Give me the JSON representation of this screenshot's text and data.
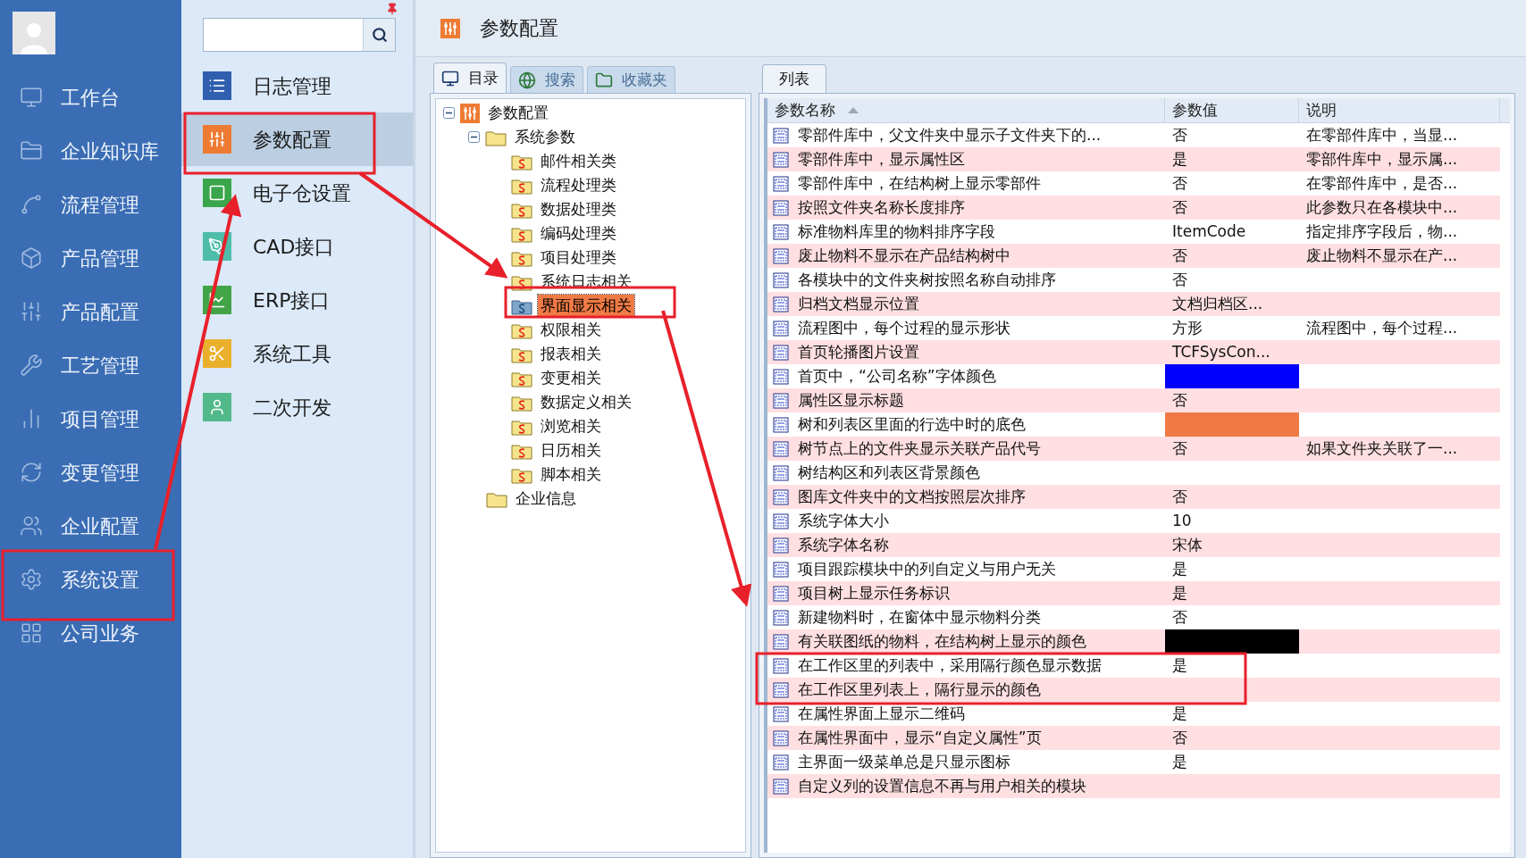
{
  "sidebar": {
    "items": [
      {
        "label": "工作台"
      },
      {
        "label": "企业知识库"
      },
      {
        "label": "流程管理"
      },
      {
        "label": "产品管理"
      },
      {
        "label": "产品配置"
      },
      {
        "label": "工艺管理"
      },
      {
        "label": "项目管理"
      },
      {
        "label": "变更管理"
      },
      {
        "label": "企业配置"
      },
      {
        "label": "系统设置"
      },
      {
        "label": "公司业务"
      }
    ]
  },
  "submenu": {
    "items": [
      {
        "label": "日志管理",
        "color": "#2f5fae",
        "selected": false
      },
      {
        "label": "参数配置",
        "color": "#ee7b33",
        "selected": true
      },
      {
        "label": "电子仓设置",
        "color": "#3aa64b",
        "selected": false
      },
      {
        "label": "CAD接口",
        "color": "#4dbdaa",
        "selected": false
      },
      {
        "label": "ERP接口",
        "color": "#43a447",
        "selected": false
      },
      {
        "label": "系统工具",
        "color": "#eab02b",
        "selected": false
      },
      {
        "label": "二次开发",
        "color": "#52b98a",
        "selected": false
      }
    ]
  },
  "page_header": {
    "title": "参数配置"
  },
  "left_tabs": [
    {
      "label": "目录",
      "selected": true
    },
    {
      "label": "搜索",
      "selected": false
    },
    {
      "label": "收藏夹",
      "selected": false
    }
  ],
  "tree": [
    {
      "label": "参数配置",
      "kind": "root",
      "expanded": true,
      "selected": false,
      "children": [
        {
          "label": "系统参数",
          "kind": "folder",
          "expanded": true,
          "selected": false,
          "children": [
            {
              "label": "邮件相关类",
              "kind": "param",
              "selected": false
            },
            {
              "label": "流程处理类",
              "kind": "param",
              "selected": false
            },
            {
              "label": "数据处理类",
              "kind": "param",
              "selected": false
            },
            {
              "label": "编码处理类",
              "kind": "param",
              "selected": false
            },
            {
              "label": "项目处理类",
              "kind": "param",
              "selected": false
            },
            {
              "label": "系统日志相关",
              "kind": "param",
              "selected": false
            },
            {
              "label": "界面显示相关",
              "kind": "param",
              "selected": true
            },
            {
              "label": "权限相关",
              "kind": "param",
              "selected": false
            },
            {
              "label": "报表相关",
              "kind": "param",
              "selected": false
            },
            {
              "label": "变更相关",
              "kind": "param",
              "selected": false
            },
            {
              "label": "数据定义相关",
              "kind": "param",
              "selected": false
            },
            {
              "label": "浏览相关",
              "kind": "param",
              "selected": false
            },
            {
              "label": "日历相关",
              "kind": "param",
              "selected": false
            },
            {
              "label": "脚本相关",
              "kind": "param",
              "selected": false
            }
          ]
        },
        {
          "label": "企业信息",
          "kind": "folder",
          "selected": false
        }
      ]
    }
  ],
  "list_tab": {
    "label": "列表",
    "selected": true
  },
  "table": {
    "columns": [
      {
        "label": "参数名称",
        "sorted": true
      },
      {
        "label": "参数值",
        "sorted": false
      },
      {
        "label": "说明",
        "sorted": false
      }
    ],
    "rows": [
      {
        "name": "零部件库中，父文件夹中显示子文件夹下的...",
        "value": "否",
        "description": "在零部件库中，当显..."
      },
      {
        "name": "零部件库中，显示属性区",
        "value": "是",
        "description": "零部件库中，显示属..."
      },
      {
        "name": "零部件库中，在结构树上显示零部件",
        "value": "否",
        "description": "在零部件库中，是否..."
      },
      {
        "name": "按照文件夹名称长度排序",
        "value": "否",
        "description": "此参数只在各模块中..."
      },
      {
        "name": "标准物料库里的物料排序字段",
        "value": "ItemCode",
        "description": "指定排序字段后，物..."
      },
      {
        "name": "废止物料不显示在产品结构树中",
        "value": "否",
        "description": "废止物料不显示在产..."
      },
      {
        "name": "各模块中的文件夹树按照名称自动排序",
        "value": "否"
      },
      {
        "name": "归档文档显示位置",
        "value": "文档归档区..."
      },
      {
        "name": "流程图中，每个过程的显示形状",
        "value": "方形",
        "description": "流程图中，每个过程..."
      },
      {
        "name": "首页轮播图片设置",
        "value": "TCFSysCon..."
      },
      {
        "name": "首页中，“公司名称”字体颜色",
        "color": "#0000ff"
      },
      {
        "name": "属性区显示标题",
        "value": "否"
      },
      {
        "name": "树和列表区里面的行选中时的底色",
        "color": "#f07a45"
      },
      {
        "name": "树节点上的文件夹显示关联产品代号",
        "value": "否",
        "description": "如果文件夹关联了一..."
      },
      {
        "name": "树结构区和列表区背景颜色"
      },
      {
        "name": "图库文件夹中的文档按照层次排序",
        "value": "否"
      },
      {
        "name": "系统字体大小",
        "value": "10"
      },
      {
        "name": "系统字体名称",
        "value": "宋体"
      },
      {
        "name": "项目跟踪模块中的列自定义与用户无关",
        "value": "是"
      },
      {
        "name": "项目树上显示任务标识",
        "value": "是"
      },
      {
        "name": "新建物料时，在窗体中显示物料分类",
        "value": "否"
      },
      {
        "name": "有关联图纸的物料，在结构树上显示的颜色",
        "color": "#000000"
      },
      {
        "name": "在工作区里的列表中，采用隔行颜色显示数据",
        "value": "是"
      },
      {
        "name": "在工作区里列表上，隔行显示的颜色"
      },
      {
        "name": "在属性界面上显示二维码",
        "value": "是"
      },
      {
        "name": "在属性界面中，显示“自定义属性”页",
        "value": "否"
      },
      {
        "name": "主界面一级菜单总是只显示图标",
        "value": "是"
      },
      {
        "name": "自定义列的设置信息不再与用户相关的模块"
      }
    ]
  }
}
